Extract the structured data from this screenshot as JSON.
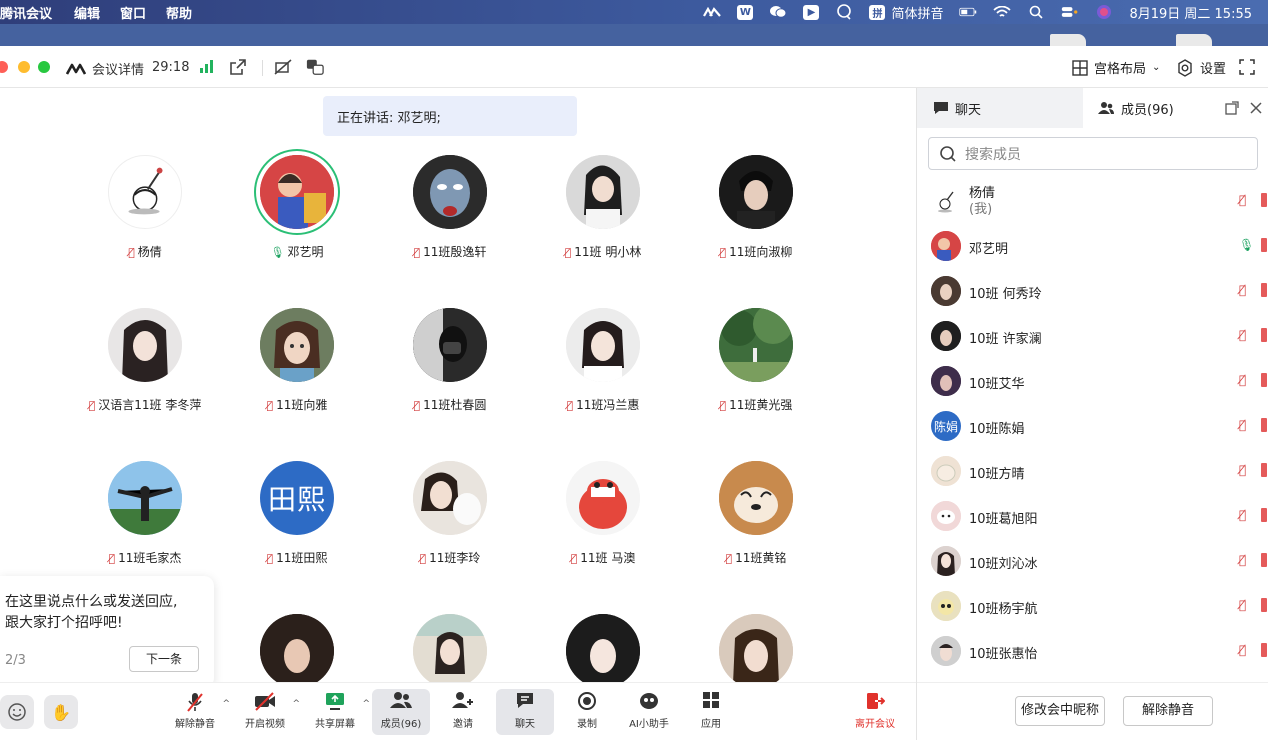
{
  "menubar": {
    "app": "腾讯会议",
    "menus": [
      "编辑",
      "窗口",
      "帮助"
    ],
    "input_method": "简体拼音",
    "date_time": "8月19日 周二  15:55"
  },
  "topbar": {
    "meeting_details": "会议详情",
    "timer": "29:18",
    "layout_label": "宫格布局",
    "settings_label": "设置"
  },
  "speaking_banner": "正在讲话: 邓艺明;",
  "tiles": [
    {
      "name": "杨倩",
      "muted": true
    },
    {
      "name": "邓艺明",
      "muted": false,
      "speaker": true
    },
    {
      "name": "11班殷逸轩",
      "muted": true
    },
    {
      "name": "11班 明小林",
      "muted": true
    },
    {
      "name": "11班向淑柳",
      "muted": true
    },
    {
      "name": "汉语言11班 李冬萍",
      "muted": true
    },
    {
      "name": "11班向雅",
      "muted": true
    },
    {
      "name": "11班杜春圆",
      "muted": true
    },
    {
      "name": "11班冯兰惠",
      "muted": true
    },
    {
      "name": "11班黄光强",
      "muted": true
    },
    {
      "name": "11班毛家杰",
      "muted": true
    },
    {
      "name": "11班田熙",
      "muted": true,
      "avatar_text": "田熙"
    },
    {
      "name": "11班李玲",
      "muted": true
    },
    {
      "name": "11班 马澳",
      "muted": true
    },
    {
      "name": "11班黄铭",
      "muted": true
    }
  ],
  "prompt": {
    "line1": "在这里说点什么或发送回应,",
    "line2": "跟大家打个招呼吧!",
    "pager": "2/3",
    "next_button": "下一条"
  },
  "toolbar": {
    "unmute": "解除静音",
    "video": "开启视频",
    "share": "共享屏幕",
    "members": "成员(96)",
    "invite": "邀请",
    "chat": "聊天",
    "record": "录制",
    "ai_assistant": "AI小助手",
    "apps": "应用",
    "leave": "离开会议"
  },
  "panel": {
    "tab_chat": "聊天",
    "tab_members": "成员(96)",
    "search_placeholder": "搜索成员",
    "members": [
      {
        "name": "杨倩",
        "sub": "(我)",
        "muted": true
      },
      {
        "name": "邓艺明",
        "muted": false
      },
      {
        "name": "10班 何秀玲",
        "muted": true
      },
      {
        "name": "10班 许家澜",
        "muted": true
      },
      {
        "name": "10班艾华",
        "muted": true
      },
      {
        "name": "10班陈娟",
        "muted": true,
        "avatar_text": "陈娟"
      },
      {
        "name": "10班方晴",
        "muted": true
      },
      {
        "name": "10班葛旭阳",
        "muted": true
      },
      {
        "name": "10班刘沁冰",
        "muted": true
      },
      {
        "name": "10班杨宇航",
        "muted": true
      },
      {
        "name": "10班张惠怡",
        "muted": true
      }
    ],
    "rename_button": "修改会中昵称",
    "unmute_button": "解除静音"
  },
  "colors": {
    "accent_blue": "#2d6bc5",
    "speaker_ring": "#2bbf76",
    "mute_red": "#d23b3b",
    "leave_red": "#e0322c"
  }
}
